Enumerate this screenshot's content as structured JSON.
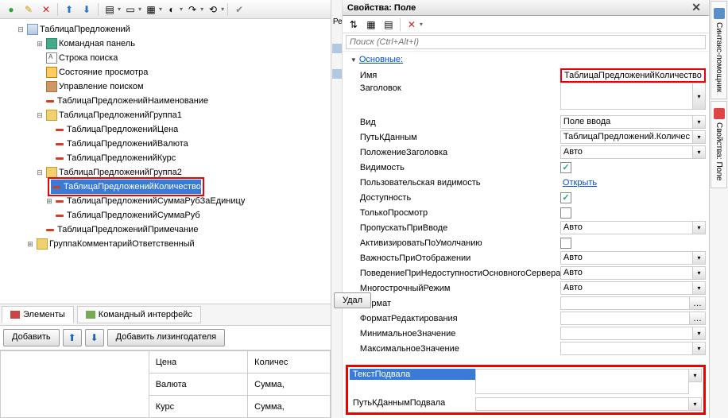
{
  "toolbar": {
    "add": "plus",
    "edit": "pencil",
    "delete": "x",
    "up": "▲",
    "down": "▼"
  },
  "tree": {
    "root": "ТаблицаПредложений",
    "cmdpanel": "Командная панель",
    "search_row": "Строка поиска",
    "view_state": "Состояние просмотра",
    "search_ctrl": "Управление поиском",
    "name_col": "ТаблицаПредложенийНаименование",
    "group1": "ТаблицаПредложенийГруппа1",
    "price": "ТаблицаПредложенийЦена",
    "currency": "ТаблицаПредложенийВалюта",
    "rate": "ТаблицаПредложенийКурс",
    "group2": "ТаблицаПредложенийГруппа2",
    "quantity": "ТаблицаПредложенийКоличество",
    "sum_rub_per": "ТаблицаПредложенийСуммаРубЗаЕдиницу",
    "sum_rub": "ТаблицаПредложенийСуммаРуб",
    "note": "ТаблицаПредложенийПримечание",
    "comment_grp": "ГруппаКомментарийОтветственный"
  },
  "left_tabs": {
    "elements": "Элементы",
    "cmdui": "Командный интерфейс"
  },
  "left_btns": {
    "add": "Добавить",
    "addlzg": "Добавить лизингодателя",
    "del": "Удал"
  },
  "ltable": {
    "h1": "",
    "h2": "Цена",
    "h3": "Количес",
    "r2c2": "Валюта",
    "r2c3": "Сумма,",
    "r3c2": "Курс",
    "r3c3": "Сумма,"
  },
  "panel_title": "Свойства: Поле",
  "search_placeholder": "Поиск (Ctrl+Alt+I)",
  "section_main": "Основные:",
  "props": {
    "name_l": "Имя",
    "name_v": "ТаблицаПредложенийКоличество",
    "title_l": "Заголовок",
    "kind_l": "Вид",
    "kind_v": "Поле ввода",
    "datapath_l": "ПутьКДанным",
    "datapath_v": "ТаблицаПредложений.Количес",
    "titlepos_l": "ПоложениеЗаголовка",
    "titlepos_v": "Авто",
    "visible_l": "Видимость",
    "uservis_l": "Пользовательская видимость",
    "uservis_v": "Открыть",
    "avail_l": "Доступность",
    "readonly_l": "ТолькоПросмотр",
    "skip_l": "ПропускатьПриВводе",
    "skip_v": "Авто",
    "activate_l": "АктивизироватьПоУмолчанию",
    "importance_l": "ВажностьПриОтображении",
    "importance_v": "Авто",
    "behavior_l": "ПоведениеПриНедоступностиОсновногоСервера",
    "behavior_v": "Авто",
    "multiline_l": "МногострочныйРежим",
    "multiline_v": "Авто",
    "format_l": "Формат",
    "editformat_l": "ФорматРедактирования",
    "minval_l": "МинимальноеЗначение",
    "maxval_l": "МаксимальноеЗначение",
    "footertext_l": "ТекстПодвала",
    "footerpath_l": "ПутьКДаннымПодвала"
  },
  "sidetabs": {
    "syntax": "Синтакс-помощник",
    "props": "Свойства: Поле"
  },
  "edge_tab": "Рекви"
}
